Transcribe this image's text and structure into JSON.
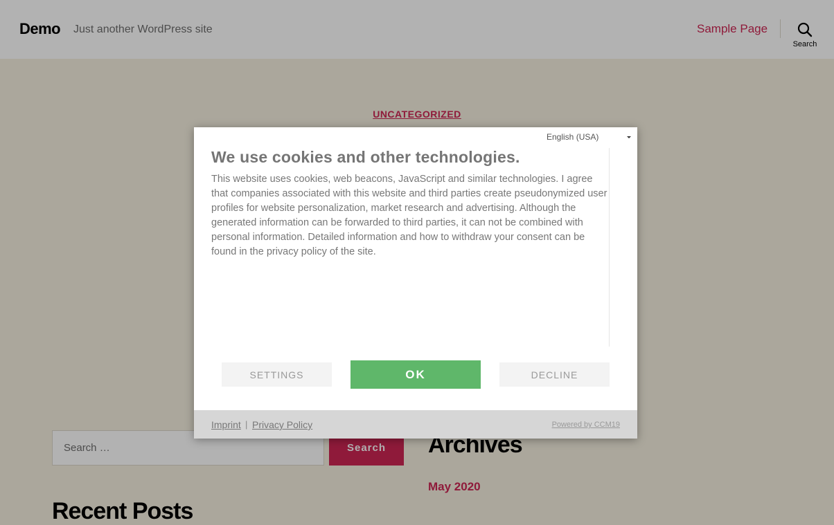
{
  "header": {
    "site_title": "Demo",
    "site_description": "Just another WordPress site",
    "nav_item": "Sample Page",
    "search_label": "Search"
  },
  "hero": {
    "category": "UNCATEGORIZED"
  },
  "sidebar": {
    "search_placeholder": "Search …",
    "search_button": "Search",
    "archives_title": "Archives",
    "archive_item": "May 2020",
    "recent_posts_title": "Recent Posts"
  },
  "cookie_modal": {
    "language": "English (USA)",
    "heading": "We use cookies and other technologies.",
    "body": "This website uses cookies, web beacons, JavaScript and similar technologies. I agree that companies associated with this website and third parties create pseudonymized user profiles for website personalization, market research and advertising. Although the generated information can be forwarded to third parties, it can not be combined with personal information. Detailed information and how to withdraw your consent can be found in the privacy policy of the site.",
    "settings_button": "SETTINGS",
    "ok_button": "OK",
    "decline_button": "DECLINE",
    "footer": {
      "imprint": "Imprint",
      "separator": "|",
      "privacy_policy": "Privacy Policy",
      "powered_by": "Powered by CCM19"
    }
  },
  "colors": {
    "accent": "#cd2653",
    "ok_green": "#5fb76a",
    "background": "#f5efe0"
  }
}
